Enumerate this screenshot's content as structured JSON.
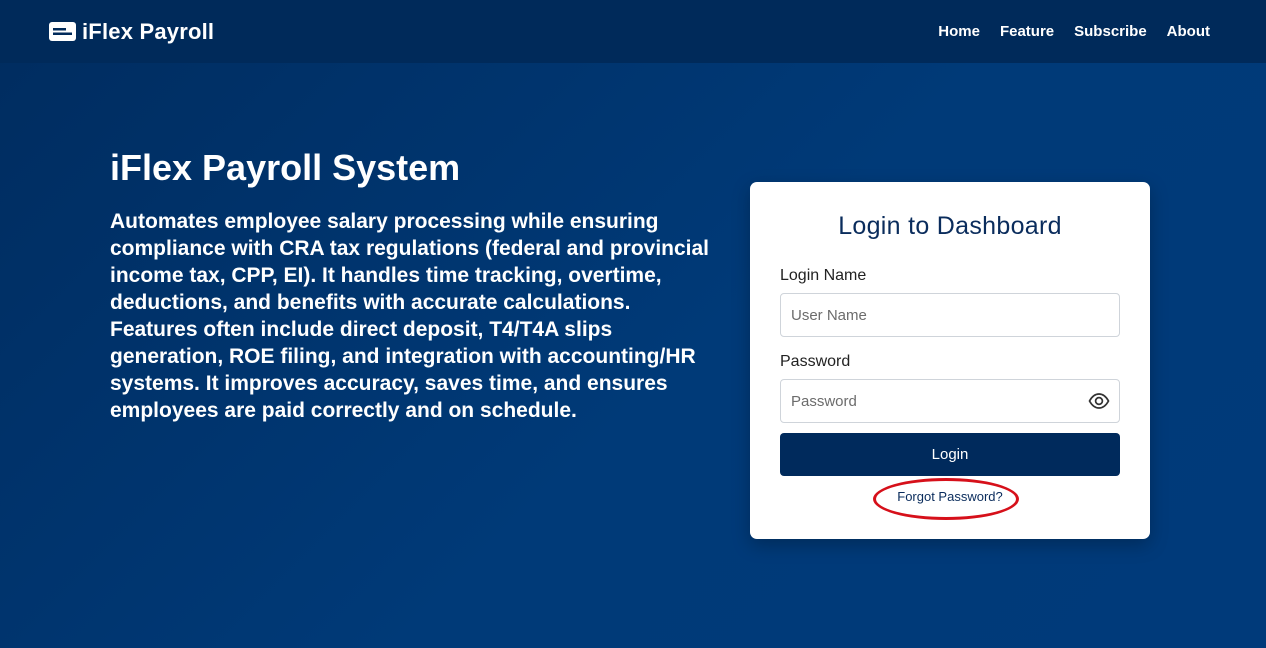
{
  "brand": {
    "name": "iFlex Payroll",
    "icon": "id-card-icon"
  },
  "nav": {
    "items": [
      "Home",
      "Feature",
      "Subscribe",
      "About"
    ]
  },
  "hero": {
    "title": "iFlex Payroll System",
    "description": "Automates employee salary processing while ensuring compliance with CRA tax regulations (federal and provincial income tax, CPP, EI). It handles time tracking, overtime, deductions, and benefits with accurate calculations. Features often include direct deposit, T4/T4A slips generation, ROE filing, and integration with accounting/HR systems. It improves accuracy, saves time, and ensures employees are paid correctly and on schedule."
  },
  "login": {
    "title": "Login to Dashboard",
    "username_label": "Login Name",
    "username_placeholder": "User Name",
    "username_value": "",
    "password_label": "Password",
    "password_placeholder": "Password",
    "password_value": "",
    "password_toggle_icon": "eye-icon",
    "submit_label": "Login",
    "forgot_label": "Forgot Password?"
  },
  "colors": {
    "background": "#003a78",
    "navbar": "#002a5a",
    "primary_button": "#002a5c",
    "heading": "#0a2c5c",
    "highlight": "#d6101a"
  }
}
